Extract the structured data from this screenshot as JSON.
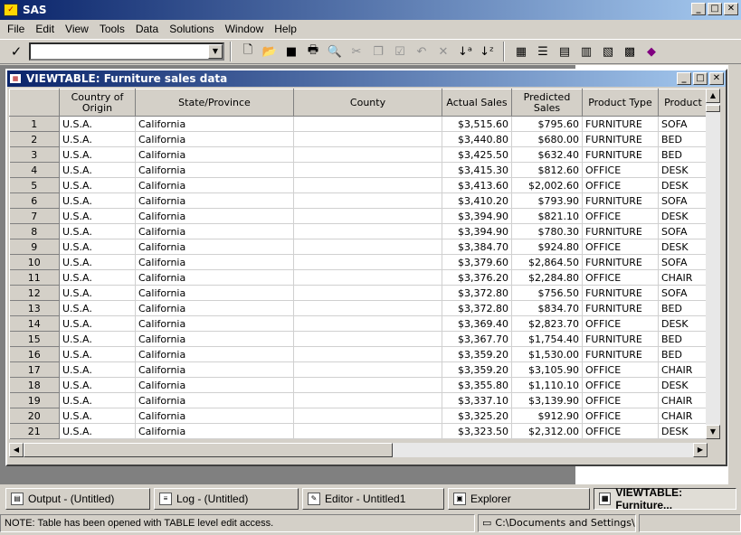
{
  "app": {
    "title": "SAS"
  },
  "menu": [
    "File",
    "Edit",
    "View",
    "Tools",
    "Data",
    "Solutions",
    "Window",
    "Help"
  ],
  "command_box": {
    "value": ""
  },
  "viewtable": {
    "title": "VIEWTABLE: Furniture sales data",
    "columns": [
      "",
      "Country of Origin",
      "State/Province",
      "County",
      "Actual Sales",
      "Predicted Sales",
      "Product Type",
      "Product"
    ],
    "rows": [
      [
        "1",
        "U.S.A.",
        "California",
        "",
        "$3,515.60",
        "$795.60",
        "FURNITURE",
        "SOFA"
      ],
      [
        "2",
        "U.S.A.",
        "California",
        "",
        "$3,440.80",
        "$680.00",
        "FURNITURE",
        "BED"
      ],
      [
        "3",
        "U.S.A.",
        "California",
        "",
        "$3,425.50",
        "$632.40",
        "FURNITURE",
        "BED"
      ],
      [
        "4",
        "U.S.A.",
        "California",
        "",
        "$3,415.30",
        "$812.60",
        "OFFICE",
        "DESK"
      ],
      [
        "5",
        "U.S.A.",
        "California",
        "",
        "$3,413.60",
        "$2,002.60",
        "OFFICE",
        "DESK"
      ],
      [
        "6",
        "U.S.A.",
        "California",
        "",
        "$3,410.20",
        "$793.90",
        "FURNITURE",
        "SOFA"
      ],
      [
        "7",
        "U.S.A.",
        "California",
        "",
        "$3,394.90",
        "$821.10",
        "OFFICE",
        "DESK"
      ],
      [
        "8",
        "U.S.A.",
        "California",
        "",
        "$3,394.90",
        "$780.30",
        "FURNITURE",
        "SOFA"
      ],
      [
        "9",
        "U.S.A.",
        "California",
        "",
        "$3,384.70",
        "$924.80",
        "OFFICE",
        "DESK"
      ],
      [
        "10",
        "U.S.A.",
        "California",
        "",
        "$3,379.60",
        "$2,864.50",
        "FURNITURE",
        "SOFA"
      ],
      [
        "11",
        "U.S.A.",
        "California",
        "",
        "$3,376.20",
        "$2,284.80",
        "OFFICE",
        "CHAIR"
      ],
      [
        "12",
        "U.S.A.",
        "California",
        "",
        "$3,372.80",
        "$756.50",
        "FURNITURE",
        "SOFA"
      ],
      [
        "13",
        "U.S.A.",
        "California",
        "",
        "$3,372.80",
        "$834.70",
        "FURNITURE",
        "BED"
      ],
      [
        "14",
        "U.S.A.",
        "California",
        "",
        "$3,369.40",
        "$2,823.70",
        "OFFICE",
        "DESK"
      ],
      [
        "15",
        "U.S.A.",
        "California",
        "",
        "$3,367.70",
        "$1,754.40",
        "FURNITURE",
        "BED"
      ],
      [
        "16",
        "U.S.A.",
        "California",
        "",
        "$3,359.20",
        "$1,530.00",
        "FURNITURE",
        "BED"
      ],
      [
        "17",
        "U.S.A.",
        "California",
        "",
        "$3,359.20",
        "$3,105.90",
        "OFFICE",
        "CHAIR"
      ],
      [
        "18",
        "U.S.A.",
        "California",
        "",
        "$3,355.80",
        "$1,110.10",
        "OFFICE",
        "DESK"
      ],
      [
        "19",
        "U.S.A.",
        "California",
        "",
        "$3,337.10",
        "$3,139.90",
        "OFFICE",
        "CHAIR"
      ],
      [
        "20",
        "U.S.A.",
        "California",
        "",
        "$3,325.20",
        "$912.90",
        "OFFICE",
        "CHAIR"
      ],
      [
        "21",
        "U.S.A.",
        "California",
        "",
        "$3,323.50",
        "$2,312.00",
        "OFFICE",
        "DESK"
      ]
    ]
  },
  "taskbar": [
    {
      "label": "Output - (Untitled)",
      "icon": "output-window-icon",
      "active": false
    },
    {
      "label": "Log - (Untitled)",
      "icon": "log-window-icon",
      "active": false
    },
    {
      "label": "Editor - Untitled1",
      "icon": "editor-window-icon",
      "active": false
    },
    {
      "label": "Explorer",
      "icon": "explorer-window-icon",
      "active": false
    },
    {
      "label": "VIEWTABLE: Furniture...",
      "icon": "viewtable-window-icon",
      "active": true
    }
  ],
  "status": {
    "message": "NOTE: Table has been opened with TABLE level edit access.",
    "path": "C:\\Documents and Settings\\lire:"
  }
}
